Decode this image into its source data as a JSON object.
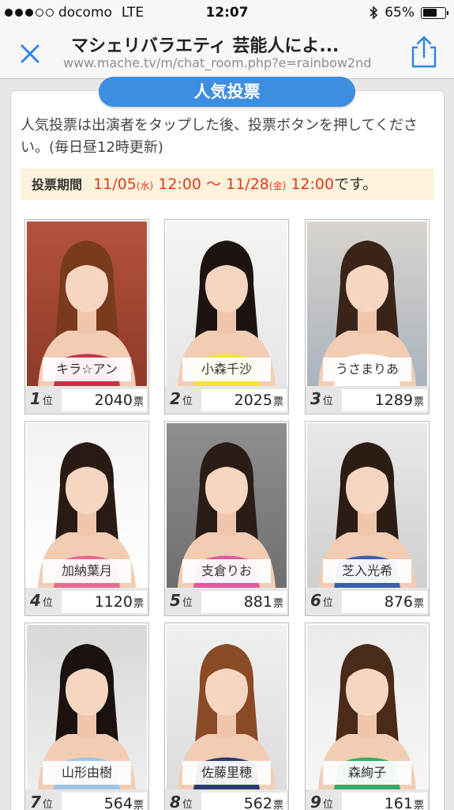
{
  "status": {
    "carrier": "docomo",
    "network": "LTE",
    "time": "12:07",
    "battery": "65%",
    "battery_level": 0.65
  },
  "browser": {
    "title": "マシェリバラエティ 芸能人によ...",
    "url": "www.mache.tv/m/chat_room.php?e=rainbow2nd"
  },
  "section": {
    "title": "人気投票",
    "description": "人気投票は出演者をタップした後、投票ボタンを押してください。(毎日昼12時更新)"
  },
  "period": {
    "label": "投票期間",
    "start_date": "11/05",
    "start_dow": "(水)",
    "start_time": "12:00",
    "separator": "〜",
    "end_date": "11/28",
    "end_dow": "(金)",
    "end_time": "12:00",
    "suffix": "です。"
  },
  "units": {
    "rank": "位",
    "votes": "票"
  },
  "ranking": [
    {
      "name": "キラ☆アン",
      "rank": "1",
      "votes": "2040"
    },
    {
      "name": "小森千沙",
      "rank": "2",
      "votes": "2025"
    },
    {
      "name": "うさまりあ",
      "rank": "3",
      "votes": "1289"
    },
    {
      "name": "加納葉月",
      "rank": "4",
      "votes": "1120"
    },
    {
      "name": "支倉りお",
      "rank": "5",
      "votes": "881"
    },
    {
      "name": "芝入光希",
      "rank": "6",
      "votes": "876"
    },
    {
      "name": "山形由樹",
      "rank": "7",
      "votes": "564"
    },
    {
      "name": "佐藤里穂",
      "rank": "8",
      "votes": "562"
    },
    {
      "name": "森絢子",
      "rank": "9",
      "votes": "161"
    }
  ],
  "colors": {
    "accent": "#3d8de0",
    "period_highlight": "#e2391c",
    "period_background": "#fdf3dc",
    "rank_row": "#e6e6e6"
  }
}
